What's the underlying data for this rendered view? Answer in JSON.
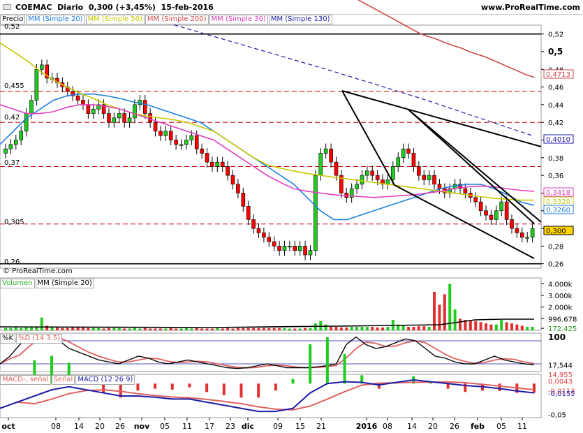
{
  "header": {
    "instrument": "COEMAC",
    "period": "Diario",
    "last": "0,300 (+3,45%)",
    "date": "15-feb-2016",
    "site": "www.ProRealTime.com",
    "copyright": "© ProRealTime.com"
  },
  "legend_price": [
    {
      "label": "Precio",
      "color": "#000000"
    },
    {
      "label": "MM (Simple 20)",
      "color": "#1e7fe0"
    },
    {
      "label": "MM (Simple 50)",
      "color": "#c8c800"
    },
    {
      "label": "MM (Simple 200)",
      "color": "#d04848"
    },
    {
      "label": "MM (Simple 30)",
      "color": "#e040c0"
    },
    {
      "label": "MM (Simple 130)",
      "color": "#1c1ca8"
    }
  ],
  "legend_volume": [
    {
      "label": "Volumen",
      "color": "#2ab02a"
    },
    {
      "label": "MM (Simple 20)",
      "color": "#000000"
    }
  ],
  "legend_stoch": [
    {
      "label": "%K",
      "color": "#000000"
    },
    {
      "label": "%D (14 3 5)",
      "color": "#e06060"
    }
  ],
  "legend_macd": [
    {
      "label": "MACD-, señal",
      "color": "#e06060"
    },
    {
      "label": "Señal",
      "color": "#e06060"
    },
    {
      "label": "MACD (12 26 9)",
      "color": "#1c1ca8"
    }
  ],
  "levels": [
    "0,52",
    "0,455",
    "0,42",
    "0,37",
    "0,305",
    "0,26"
  ],
  "colors": {
    "up": "#1fcc1f",
    "down": "#ff0000",
    "bg": "#ffffff",
    "grid": "#cc0000",
    "ma20": "#1e7fe0",
    "ma50": "#c8c800",
    "ma200": "#d04848",
    "ma30": "#e040c0",
    "ma130": "#1c1ca8",
    "vol": "#1fcc1f",
    "volDown": "#e03030"
  },
  "chart_data": [
    {
      "type": "candlestick",
      "panel": "price",
      "x_ticks": [
        "oct",
        "08",
        "14",
        "20",
        "26",
        "nov",
        "05",
        "11",
        "17",
        "23",
        "dic",
        "09",
        "15",
        "21",
        "2016",
        "08",
        "14",
        "20",
        "26",
        "feb",
        "05",
        "11"
      ],
      "ylim": [
        0.255,
        0.53
      ],
      "y_ticks": [
        "0,52",
        "0,5",
        "0,48",
        "0,46",
        "0,44",
        "0,42",
        "0,4",
        "0,38",
        "0,36",
        "0,34",
        "0,32",
        "0,3",
        "0,28",
        "0,26"
      ],
      "y_tick_values": [
        0.52,
        0.5,
        0.48,
        0.46,
        0.44,
        0.42,
        0.4,
        0.38,
        0.36,
        0.34,
        0.32,
        0.3,
        0.28,
        0.26
      ],
      "horizontal_levels": [
        0.52,
        0.455,
        0.42,
        0.37,
        0.305,
        0.26
      ],
      "value_tags": [
        {
          "label": "0,4713",
          "color": "#d04848"
        },
        {
          "label": "0,4010",
          "color": "#1c1ca8"
        },
        {
          "label": "0,3418",
          "color": "#e040c0"
        },
        {
          "label": "0,3320",
          "color": "#c8c800"
        },
        {
          "label": "0,3260",
          "color": "#1e7fe0"
        },
        {
          "label": "0,300",
          "color": "#000000"
        }
      ],
      "close": [
        0.39,
        0.395,
        0.4,
        0.41,
        0.43,
        0.445,
        0.48,
        0.485,
        0.47,
        0.47,
        0.465,
        0.46,
        0.455,
        0.45,
        0.445,
        0.44,
        0.43,
        0.435,
        0.44,
        0.43,
        0.42,
        0.425,
        0.43,
        0.42,
        0.425,
        0.44,
        0.445,
        0.43,
        0.42,
        0.41,
        0.405,
        0.41,
        0.4,
        0.395,
        0.395,
        0.4,
        0.405,
        0.39,
        0.385,
        0.375,
        0.37,
        0.375,
        0.37,
        0.36,
        0.35,
        0.34,
        0.325,
        0.31,
        0.3,
        0.295,
        0.29,
        0.285,
        0.28,
        0.275,
        0.28,
        0.28,
        0.275,
        0.28,
        0.27,
        0.275,
        0.36,
        0.385,
        0.39,
        0.375,
        0.36,
        0.34,
        0.335,
        0.345,
        0.35,
        0.36,
        0.365,
        0.36,
        0.355,
        0.35,
        0.355,
        0.37,
        0.38,
        0.39,
        0.385,
        0.37,
        0.36,
        0.355,
        0.36,
        0.35,
        0.345,
        0.34,
        0.345,
        0.35,
        0.345,
        0.34,
        0.335,
        0.33,
        0.32,
        0.315,
        0.31,
        0.32,
        0.33,
        0.31,
        0.3,
        0.295,
        0.29,
        0.29,
        0.3
      ],
      "series": [
        {
          "name": "MM (Simple 20)",
          "color": "#1e7fe0",
          "values": [
            0.395,
            0.41,
            0.425,
            0.435,
            0.445,
            0.45,
            0.452,
            0.452,
            0.45,
            0.447,
            0.443,
            0.44,
            0.435,
            0.43,
            0.425,
            0.42,
            0.41,
            0.4,
            0.39,
            0.38,
            0.37,
            0.36,
            0.35,
            0.335,
            0.32,
            0.31,
            0.31,
            0.315,
            0.32,
            0.325,
            0.33,
            0.335,
            0.34,
            0.345,
            0.348,
            0.35,
            0.35,
            0.345,
            0.338,
            0.33,
            0.326
          ]
        },
        {
          "name": "MM (Simple 50)",
          "color": "#c8c800",
          "values": [
            0.51,
            0.5,
            0.49,
            0.478,
            0.468,
            0.46,
            0.453,
            0.447,
            0.44,
            0.435,
            0.43,
            0.427,
            0.425,
            0.423,
            0.42,
            0.415,
            0.41,
            0.4,
            0.39,
            0.38,
            0.372,
            0.368,
            0.365,
            0.362,
            0.36,
            0.358,
            0.356,
            0.354,
            0.352,
            0.35,
            0.348,
            0.346,
            0.344,
            0.342,
            0.34,
            0.338,
            0.336,
            0.334,
            0.333,
            0.332,
            0.332
          ]
        },
        {
          "name": "MM (Simple 200)",
          "color": "#d04848",
          "values": [
            0.56,
            0.555,
            0.55,
            0.545,
            0.54,
            0.535,
            0.53,
            0.525,
            0.52,
            0.517,
            0.514,
            0.51,
            0.507,
            0.504,
            0.5,
            0.497,
            0.494,
            0.49,
            0.486,
            0.482,
            0.478,
            0.474,
            0.471
          ]
        },
        {
          "name": "MM (Simple 30)",
          "color": "#e040c0",
          "values": [
            0.44,
            0.435,
            0.43,
            0.43,
            0.432,
            0.437,
            0.44,
            0.44,
            0.438,
            0.435,
            0.43,
            0.425,
            0.42,
            0.415,
            0.41,
            0.405,
            0.4,
            0.39,
            0.38,
            0.37,
            0.36,
            0.352,
            0.345,
            0.342,
            0.34,
            0.338,
            0.337,
            0.336,
            0.335,
            0.336,
            0.337,
            0.338,
            0.34,
            0.342,
            0.345,
            0.347,
            0.348,
            0.347,
            0.345,
            0.343,
            0.342
          ]
        }
      ],
      "trendlines_note": "drawn channel and resistance lines"
    },
    {
      "type": "bar",
      "panel": "volume",
      "y_ticks": [
        "4.000k",
        "3.000k",
        "2.000k",
        "996.678",
        "172.425"
      ],
      "y_tick_values": [
        4000000,
        3000000,
        2000000,
        996678,
        172425
      ],
      "ylim": [
        0,
        4500000
      ]
    },
    {
      "type": "line",
      "panel": "stochastic",
      "y_ticks": [
        "100",
        "17,544",
        "14,955"
      ],
      "ylim": [
        0,
        100
      ]
    },
    {
      "type": "line",
      "panel": "macd",
      "y_ticks": [
        "0,0043",
        "-0,0113",
        "-0,0155",
        "-0,05"
      ],
      "ylim": [
        -0.055,
        0.015
      ]
    }
  ]
}
